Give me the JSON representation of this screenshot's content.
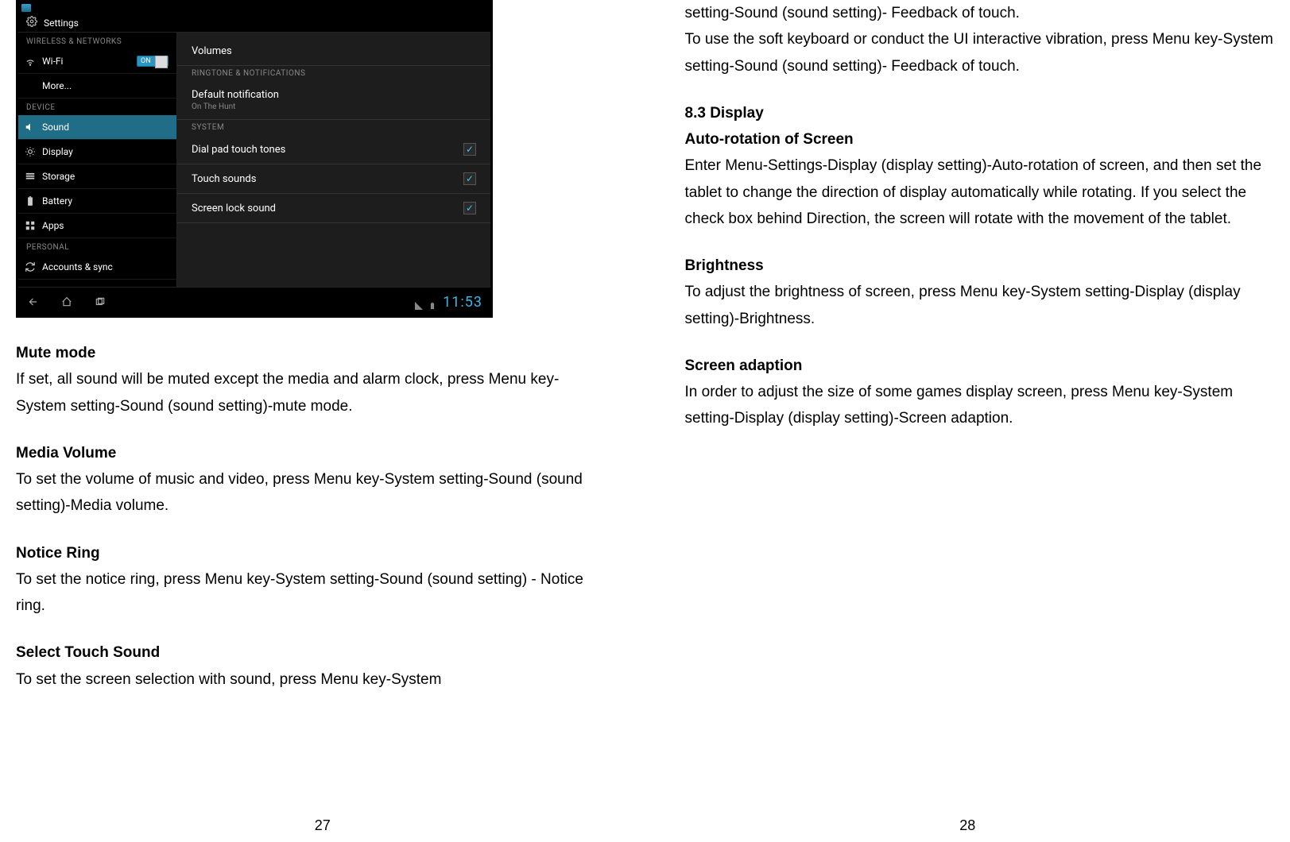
{
  "pages": {
    "left": "27",
    "right": "28"
  },
  "screenshot": {
    "app_title": "Settings",
    "sidebar": {
      "section_wireless": "WIRELESS & NETWORKS",
      "wifi": "Wi-Fi",
      "wifi_switch": "ON",
      "more": "More...",
      "section_device": "DEVICE",
      "sound": "Sound",
      "display": "Display",
      "storage": "Storage",
      "battery": "Battery",
      "apps": "Apps",
      "section_personal": "PERSONAL",
      "accounts": "Accounts & sync"
    },
    "panel": {
      "volumes": "Volumes",
      "section_ringtone": "RINGTONE & NOTIFICATIONS",
      "default_notif": "Default notification",
      "default_notif_sub": "On The Hunt",
      "section_system": "SYSTEM",
      "dial_pad": "Dial pad touch tones",
      "touch_sounds": "Touch sounds",
      "screen_lock": "Screen lock sound"
    },
    "clock": "11:53"
  },
  "left": {
    "h_mute": "Mute mode",
    "p_mute": "If set, all sound will be muted except the media and alarm clock, press Menu key-System setting-Sound (sound setting)-mute mode.",
    "h_media": "Media Volume",
    "p_media": "To set the volume of music and video, press Menu key-System setting-Sound (sound setting)-Media volume.",
    "h_notice": "Notice Ring",
    "p_notice": "To set the notice ring, press Menu key-System setting-Sound (sound setting) - Notice ring.",
    "h_touch": "Select Touch Sound",
    "p_touch": "To set the screen selection with sound, press Menu key-System"
  },
  "right": {
    "p_cont1": "setting-Sound (sound setting)- Feedback of touch.",
    "p_cont2": "To use the soft keyboard or conduct the UI interactive vibration, press Menu key-System setting-Sound (sound setting)- Feedback of touch.",
    "h_83": "8.3 Display",
    "h_auto": "Auto-rotation of Screen",
    "p_auto": "Enter Menu-Settings-Display (display setting)-Auto-rotation of screen, and then set the tablet to change the direction of display automatically while rotating. If you select the check box behind Direction, the screen will rotate with the movement of the tablet.",
    "h_bright": "Brightness",
    "p_bright": "To adjust the brightness of screen, press Menu key-System setting-Display (display setting)-Brightness.",
    "h_adapt": "Screen adaption",
    "p_adapt": "In order to adjust the size of some games display screen, press Menu key-System setting-Display (display setting)-Screen adaption."
  }
}
